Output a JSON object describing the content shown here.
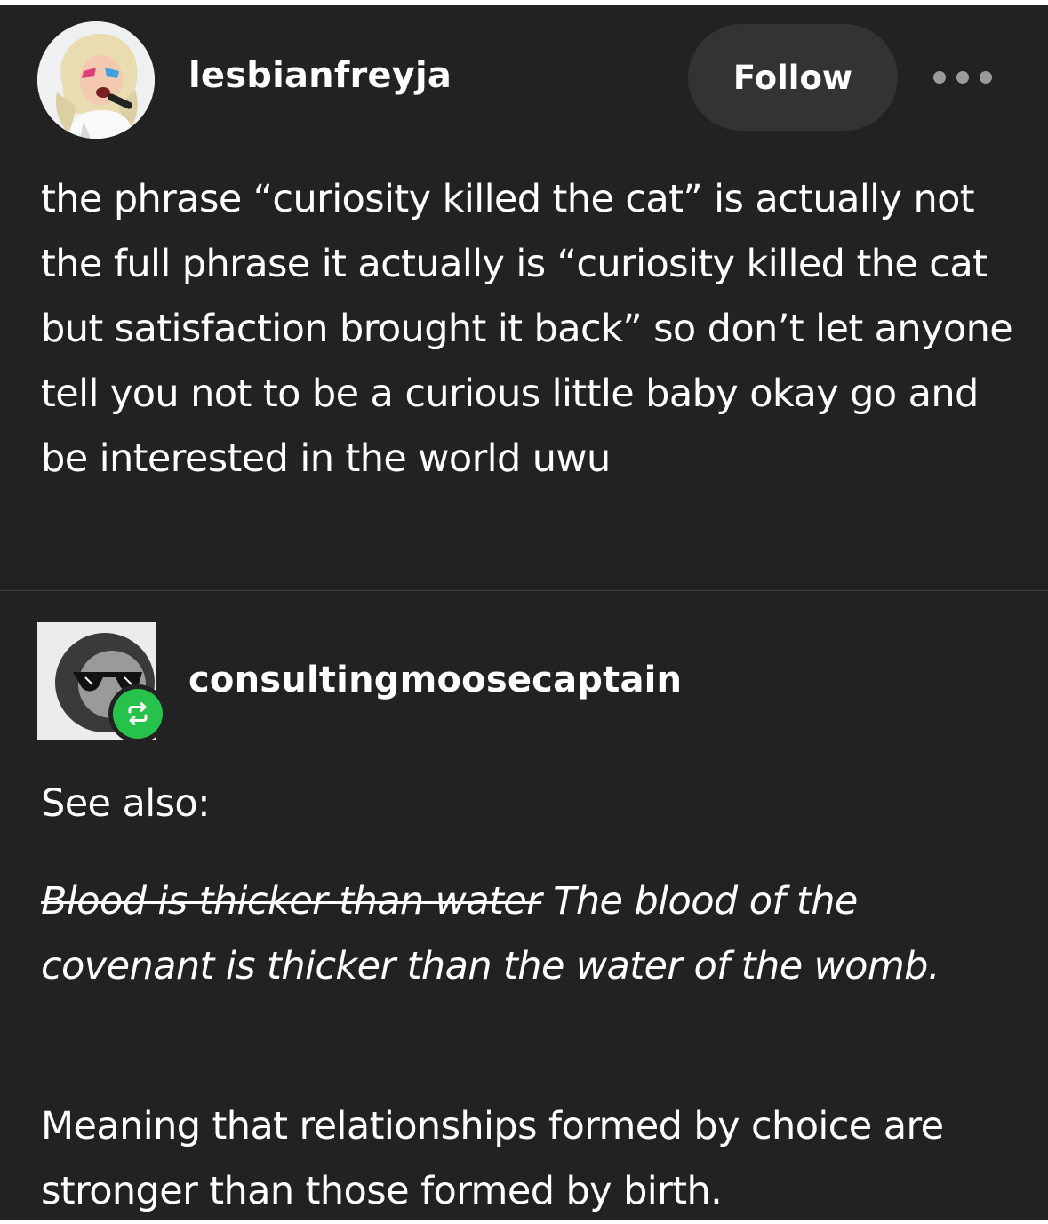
{
  "post": {
    "username": "lesbianfreyja",
    "follow_label": "Follow",
    "more_icon": "more-horizontal-icon",
    "body": "the phrase “curiosity killed the cat” is actually not the full phrase it actually is “curiosity killed the cat but satisfaction brought it back” so don’t let anyone tell you not to be a curious little baby okay go and be interested in the world uwu"
  },
  "reblog": {
    "username": "consultingmoosecaptain",
    "badge_icon": "reblog-icon",
    "badge_color": "#27c24c",
    "see_also": "See also:",
    "quote_struck": "Blood is thicker than water",
    "quote_rest": " The blood of the covenant is thicker than the water of the womb.",
    "meaning": "Meaning that relationships formed by choice are stronger than those formed by birth."
  },
  "colors": {
    "background": "#222222",
    "follow_button": "#333333",
    "text": "#ffffff",
    "divider": "#3d3d3d"
  }
}
